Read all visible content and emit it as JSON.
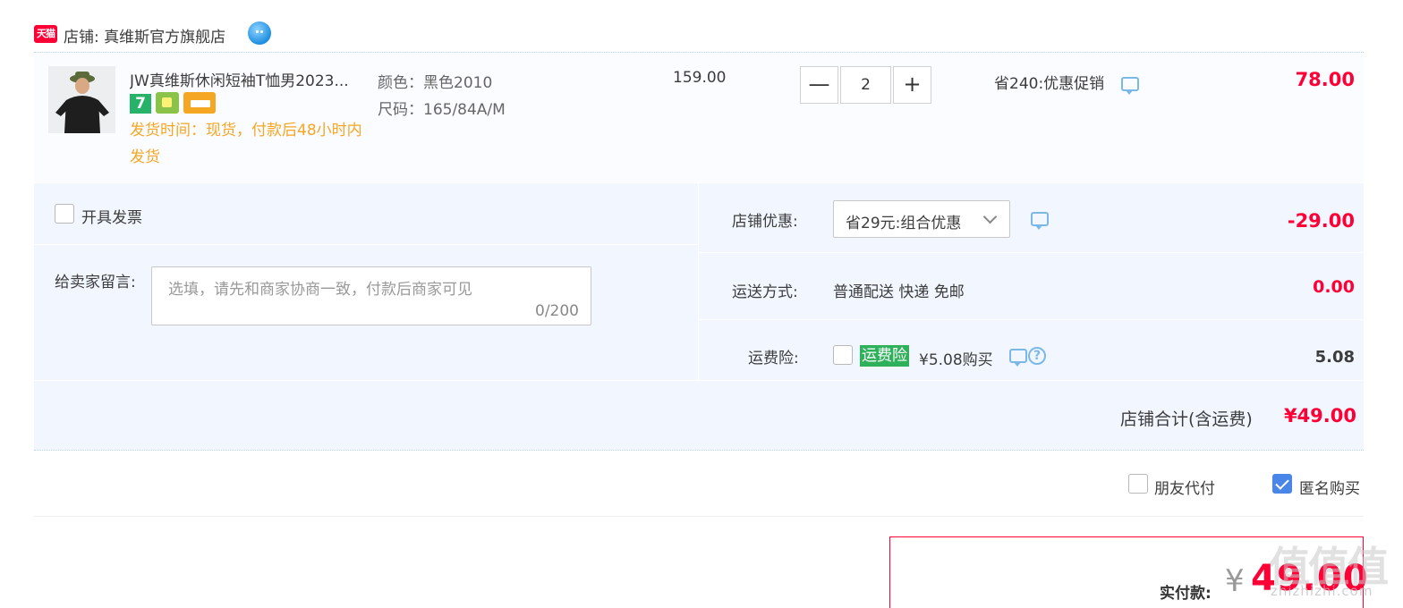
{
  "shop": {
    "badge": "天猫",
    "name": "店铺: 真维斯官方旗舰店"
  },
  "item": {
    "title": "JW真维斯休闲短袖T恤男2023...",
    "badge_seven": "7",
    "ship_time": "发货时间：现货，付款后48小时内发货",
    "color": "颜色：黑色2010",
    "size": "尺码：165/84A/M",
    "unit_price": "159.00",
    "quantity": "2",
    "minus": "—",
    "plus": "+",
    "promo": "省240:优惠促销",
    "total": "78.00"
  },
  "options": {
    "invoice_label": "开具发票",
    "message_label": "给卖家留言:",
    "message_placeholder": "选填，请先和商家协商一致，付款后商家可见",
    "message_counter": "0/200",
    "shop_discount_label": "店铺优惠:",
    "shop_discount_value": "省29元:组合优惠",
    "shop_discount_amount": "-29.00",
    "shipping_label": "运送方式:",
    "shipping_value": "普通配送 快递 免邮",
    "shipping_amount": "0.00",
    "insurance_label": "运费险:",
    "insurance_tag": "运费险",
    "insurance_value": "¥5.08购买",
    "insurance_amount": "5.08",
    "shop_total_label": "店铺合计(含运费)",
    "shop_total": "¥49.00"
  },
  "footer": {
    "friend_pay": "朋友代付",
    "anonymous": "匿名购买",
    "anonymous_checked": true,
    "pay_label": "实付款:",
    "pay_currency": "¥",
    "pay_amount": "49.00",
    "watermark": "值值值",
    "watermark_sub": "zhizhizhi.com"
  },
  "colors": {
    "price_red": "#ff0036",
    "ship_orange": "#f6a623",
    "panel_blue": "#f2f7ff",
    "insurance_green": "#2fb15b",
    "check_blue": "#4a86e8"
  }
}
